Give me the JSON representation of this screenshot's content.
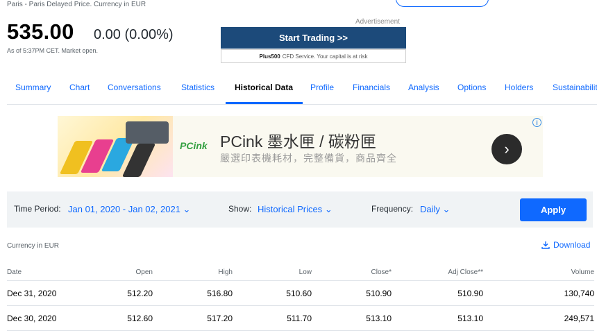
{
  "quote": {
    "exchange_line": "Paris - Paris Delayed Price. Currency in EUR",
    "price": "535.00",
    "change": "0.00 (0.00%)",
    "as_of": "As of 5:37PM CET. Market open."
  },
  "advert": {
    "label": "Advertisement",
    "button": "Start Trading >>",
    "disclaimer_brand": "Plus500",
    "disclaimer_text": "CFD Service. Your capital is at risk"
  },
  "tabs": [
    "Summary",
    "Chart",
    "Conversations",
    "Statistics",
    "Historical Data",
    "Profile",
    "Financials",
    "Analysis",
    "Options",
    "Holders",
    "Sustainability"
  ],
  "active_tab": "Historical Data",
  "banner": {
    "logo": "PCink",
    "title": "PCink 墨水匣 / 碳粉匣",
    "subtitle": "嚴選印表機耗材，完整備貨，商品齊全",
    "arrow": "›",
    "info": "i"
  },
  "filter": {
    "time_period_label": "Time Period:",
    "time_period_value": "Jan 01, 2020 - Jan 02, 2021",
    "show_label": "Show:",
    "show_value": "Historical Prices",
    "frequency_label": "Frequency:",
    "frequency_value": "Daily",
    "apply": "Apply"
  },
  "currency_note": "Currency in EUR",
  "download": "Download",
  "table": {
    "headers": [
      "Date",
      "Open",
      "High",
      "Low",
      "Close*",
      "Adj Close**",
      "Volume"
    ],
    "rows": [
      [
        "Dec 31, 2020",
        "512.20",
        "516.80",
        "510.60",
        "510.90",
        "510.90",
        "130,740"
      ],
      [
        "Dec 30, 2020",
        "512.60",
        "517.20",
        "511.70",
        "513.10",
        "513.10",
        "249,571"
      ]
    ]
  },
  "colors": {
    "accent": "#0f69ff",
    "ad_button": "#1c4a7a",
    "filter_bg": "#f0f3f5"
  }
}
